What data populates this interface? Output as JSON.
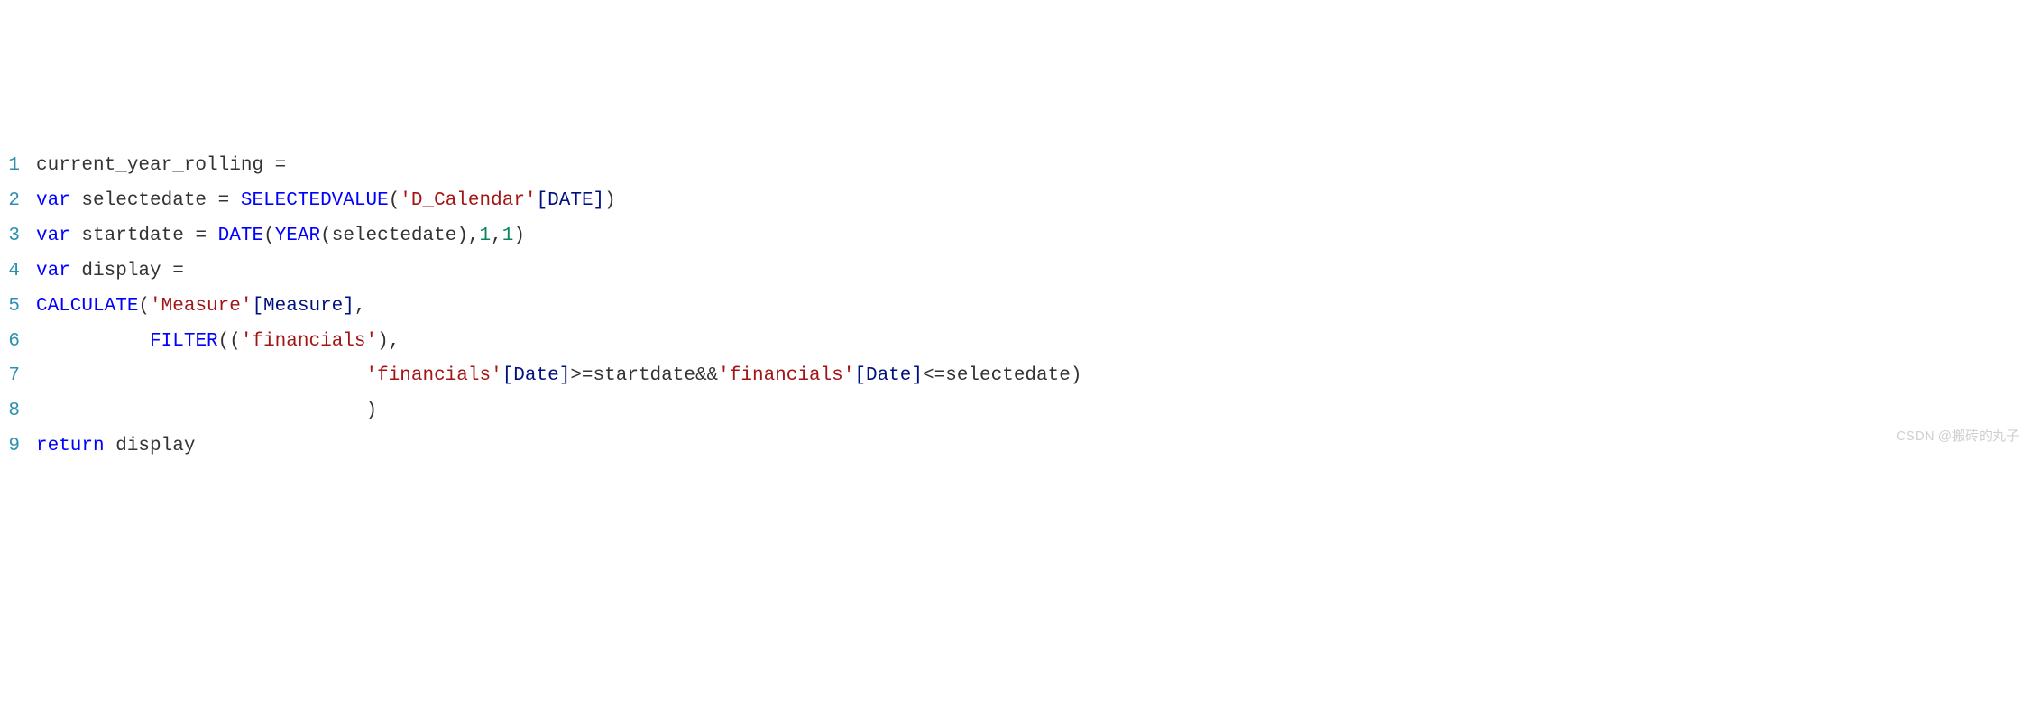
{
  "lines": [
    {
      "num": "1",
      "tokens": [
        {
          "t": "current_year_rolling ",
          "c": "identifier"
        },
        {
          "t": "=",
          "c": "operator"
        }
      ]
    },
    {
      "num": "2",
      "tokens": [
        {
          "t": "var",
          "c": "keyword"
        },
        {
          "t": " selectedate ",
          "c": "identifier"
        },
        {
          "t": "=",
          "c": "operator"
        },
        {
          "t": " ",
          "c": "identifier"
        },
        {
          "t": "SELECTEDVALUE",
          "c": "function"
        },
        {
          "t": "(",
          "c": "operator"
        },
        {
          "t": "'D_Calendar'",
          "c": "string"
        },
        {
          "t": "[DATE]",
          "c": "measure-text"
        },
        {
          "t": ")",
          "c": "operator"
        }
      ]
    },
    {
      "num": "3",
      "tokens": [
        {
          "t": "var",
          "c": "keyword"
        },
        {
          "t": " startdate ",
          "c": "identifier"
        },
        {
          "t": "=",
          "c": "operator"
        },
        {
          "t": " ",
          "c": "identifier"
        },
        {
          "t": "DATE",
          "c": "function"
        },
        {
          "t": "(",
          "c": "operator"
        },
        {
          "t": "YEAR",
          "c": "function"
        },
        {
          "t": "(selectedate),",
          "c": "identifier"
        },
        {
          "t": "1",
          "c": "number"
        },
        {
          "t": ",",
          "c": "identifier"
        },
        {
          "t": "1",
          "c": "number"
        },
        {
          "t": ")",
          "c": "operator"
        }
      ]
    },
    {
      "num": "4",
      "tokens": [
        {
          "t": "var",
          "c": "keyword"
        },
        {
          "t": " display ",
          "c": "identifier"
        },
        {
          "t": "=",
          "c": "operator"
        }
      ]
    },
    {
      "num": "5",
      "tokens": [
        {
          "t": "CALCULATE",
          "c": "function"
        },
        {
          "t": "(",
          "c": "operator"
        },
        {
          "t": "'Measure'",
          "c": "string"
        },
        {
          "t": "[Measure]",
          "c": "measure-text"
        },
        {
          "t": ",",
          "c": "operator"
        }
      ]
    },
    {
      "num": "6",
      "tokens": [
        {
          "t": "          ",
          "c": "identifier"
        },
        {
          "t": "FILTER",
          "c": "function"
        },
        {
          "t": "((",
          "c": "operator"
        },
        {
          "t": "'financials'",
          "c": "string"
        },
        {
          "t": "),",
          "c": "operator"
        }
      ]
    },
    {
      "num": "7",
      "tokens": [
        {
          "t": "                             ",
          "c": "identifier"
        },
        {
          "t": "'financials'",
          "c": "string"
        },
        {
          "t": "[Date]",
          "c": "measure-text"
        },
        {
          "t": ">=startdate&&",
          "c": "identifier"
        },
        {
          "t": "'financials'",
          "c": "string"
        },
        {
          "t": "[Date]",
          "c": "measure-text"
        },
        {
          "t": "<=selectedate)",
          "c": "identifier"
        }
      ]
    },
    {
      "num": "8",
      "tokens": [
        {
          "t": "                             )",
          "c": "identifier"
        }
      ]
    },
    {
      "num": "9",
      "tokens": [
        {
          "t": "return",
          "c": "keyword"
        },
        {
          "t": " display",
          "c": "identifier"
        }
      ]
    }
  ],
  "watermark": "CSDN @搬砖的丸子"
}
